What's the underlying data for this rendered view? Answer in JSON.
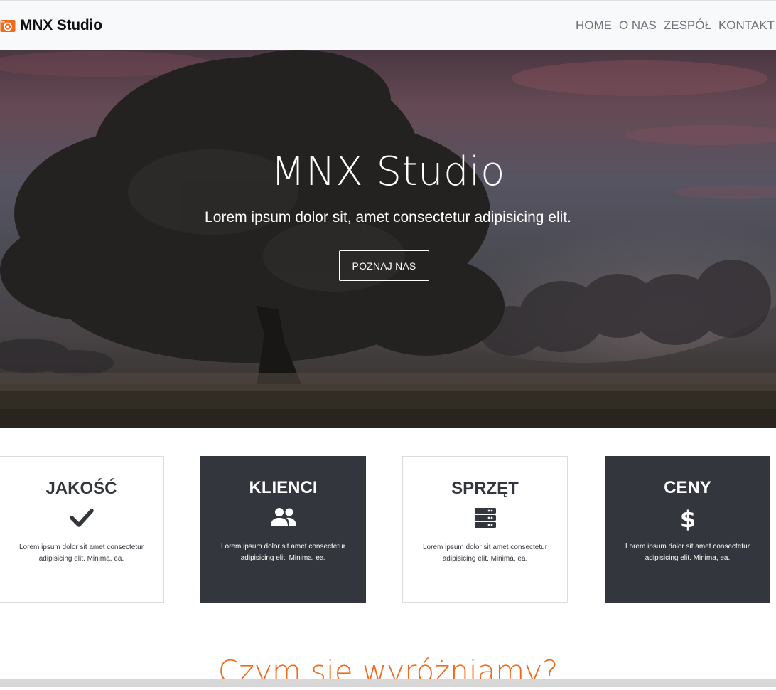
{
  "navbar": {
    "brand": "MNX Studio",
    "brand_icon": "camera-icon",
    "items": [
      "HOME",
      "O NAS",
      "ZESPÓŁ",
      "KONTAKT"
    ]
  },
  "hero": {
    "title": "MNX Studio",
    "subtitle": "Lorem ipsum dolor sit, amet consectetur adipisicing elit.",
    "button": "POZNAJ NAS"
  },
  "features": [
    {
      "title": "JAKOŚĆ",
      "icon": "check-icon",
      "text": "Lorem ipsum dolor sit amet consectetur adipisicing elit. Minima, ea.",
      "theme": "light"
    },
    {
      "title": "KLIENCI",
      "icon": "users-icon",
      "text": "Lorem ipsum dolor sit amet consectetur adipisicing elit. Minima, ea.",
      "theme": "dark"
    },
    {
      "title": "SPRZĘT",
      "icon": "server-icon",
      "text": "Lorem ipsum dolor sit amet consectetur adipisicing elit. Minima, ea.",
      "theme": "light"
    },
    {
      "title": "CENY",
      "icon": "dollar-icon",
      "text": "Lorem ipsum dolor sit amet consectetur adipisicing elit. Minima, ea.",
      "theme": "dark"
    }
  ],
  "section": {
    "title": "Czym się wyróżniamy?"
  },
  "colors": {
    "accent": "#f06a1c",
    "dark": "#33363c",
    "navbar_bg": "#f8f9fa"
  }
}
